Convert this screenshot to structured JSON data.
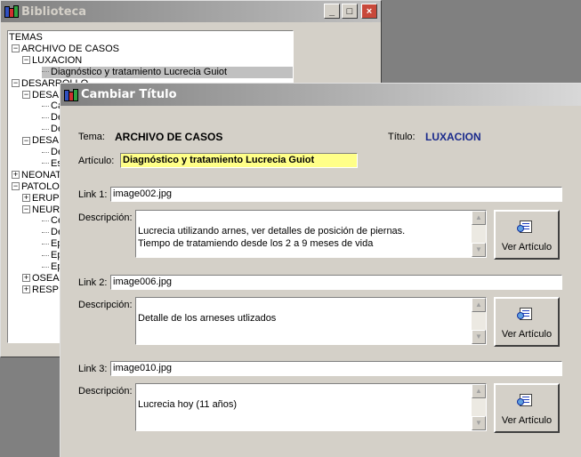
{
  "biblioteca": {
    "title": "Biblioteca",
    "window_buttons": {
      "minimize": "_",
      "maximize": "□",
      "close": "×"
    },
    "tree": [
      {
        "label": "TEMAS",
        "box": ""
      },
      {
        "label": "ARCHIVO DE CASOS",
        "box": "−"
      },
      {
        "label": "LUXACION",
        "box": "−"
      },
      {
        "label": "Diagnóstico y tratamiento Lucrecia Guiot",
        "box": "",
        "selected": true
      },
      {
        "label": "DESARROLLO",
        "box": "−"
      },
      {
        "label": "DESA",
        "box": "−"
      },
      {
        "label": "Ca",
        "box": ""
      },
      {
        "label": "De",
        "box": ""
      },
      {
        "label": "De",
        "box": ""
      },
      {
        "label": "DESA",
        "box": "−"
      },
      {
        "label": "De",
        "box": ""
      },
      {
        "label": "Es",
        "box": ""
      },
      {
        "label": "NEONATO",
        "box": "+"
      },
      {
        "label": "PATOLO",
        "box": "−"
      },
      {
        "label": "ERUP",
        "box": "+"
      },
      {
        "label": "NEUR",
        "box": "−"
      },
      {
        "label": "Ce",
        "box": ""
      },
      {
        "label": "De",
        "box": ""
      },
      {
        "label": "Ep",
        "box": ""
      },
      {
        "label": "Ep",
        "box": ""
      },
      {
        "label": "Ep",
        "box": ""
      },
      {
        "label": "OSEA",
        "box": "+"
      },
      {
        "label": "RESP",
        "box": "+"
      }
    ]
  },
  "dialog": {
    "title": "Cambiar Título",
    "tema_label": "Tema:",
    "tema_value": "ARCHIVO DE CASOS",
    "titulo_label": "Título:",
    "titulo_value": "LUXACION",
    "articulo_label": "Artículo:",
    "articulo_value": "Diagnóstico y tratamiento Lucrecia Guiot",
    "descripcion_label": "Descripción:",
    "ver_articulo_label": "Ver Artículo",
    "links": [
      {
        "label": "Link 1:",
        "value": "image002.jpg",
        "descripcion": "Lucrecia utilizando arnes, ver detalles de posición de piernas.\nTiempo de tratamiendo desde los 2 a 9 meses de vida"
      },
      {
        "label": "Link 2:",
        "value": "image006.jpg",
        "descripcion": "Detalle de los arneses utlizados"
      },
      {
        "label": "Link 3:",
        "value": "image010.jpg",
        "descripcion": "Lucrecia hoy (11 años)"
      }
    ]
  }
}
